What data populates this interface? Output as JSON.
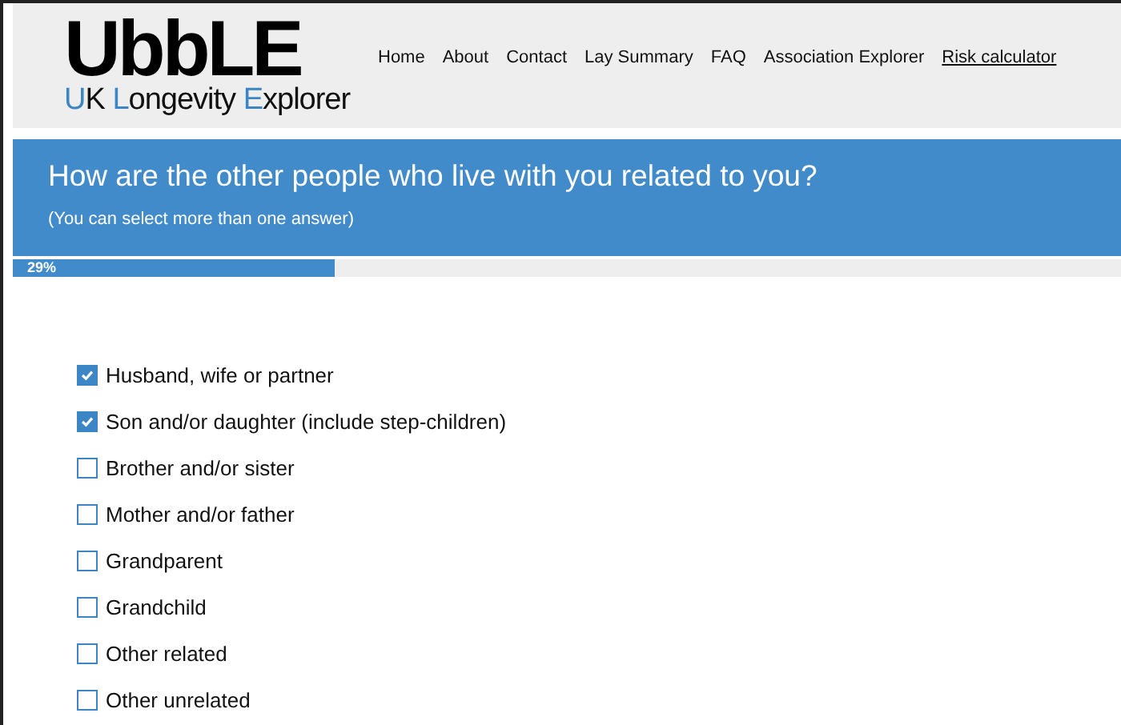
{
  "logo": {
    "title": "UbbLE",
    "subtitle_parts": [
      {
        "text": "U",
        "highlight": true
      },
      {
        "text": "K ",
        "highlight": false
      },
      {
        "text": "L",
        "highlight": true
      },
      {
        "text": "ongevity ",
        "highlight": false
      },
      {
        "text": "E",
        "highlight": true
      },
      {
        "text": "xplorer",
        "highlight": false
      }
    ]
  },
  "nav": [
    {
      "label": "Home",
      "selected": false
    },
    {
      "label": "About",
      "selected": false
    },
    {
      "label": "Contact",
      "selected": false
    },
    {
      "label": "Lay Summary",
      "selected": false
    },
    {
      "label": "FAQ",
      "selected": false
    },
    {
      "label": "Association Explorer",
      "selected": false
    },
    {
      "label": "Risk calculator",
      "selected": true
    }
  ],
  "question": {
    "title": "How are the other people who live with you related to you?",
    "hint": "(You can select more than one answer)"
  },
  "progress": {
    "label": "29%",
    "level": 0.29
  },
  "options": [
    {
      "label": "Husband, wife or partner",
      "checked": true
    },
    {
      "label": "Son and/or daughter (include step-children)",
      "checked": true
    },
    {
      "label": "Brother and/or sister",
      "checked": false
    },
    {
      "label": "Mother and/or father",
      "checked": false
    },
    {
      "label": "Grandparent",
      "checked": false
    },
    {
      "label": "Grandchild",
      "checked": false
    },
    {
      "label": "Other related",
      "checked": false
    },
    {
      "label": "Other unrelated",
      "checked": false
    }
  ]
}
